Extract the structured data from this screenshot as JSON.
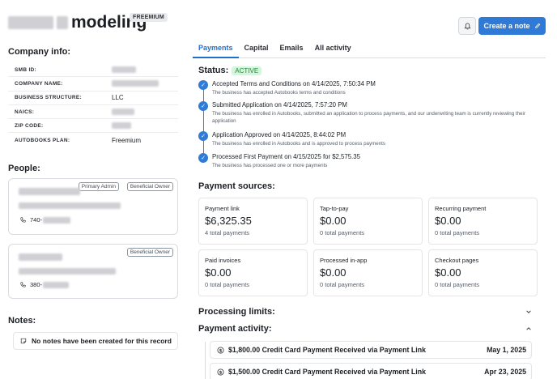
{
  "header": {
    "title_suffix": "modeling",
    "plan_badge": "FREEMIUM",
    "create_note_label": "Create a note",
    "bell_icon": "bell-icon",
    "pencil_icon": "pencil-icon"
  },
  "company_info": {
    "heading": "Company info:",
    "rows": [
      {
        "key": "SMB ID:",
        "value": null
      },
      {
        "key": "COMPANY NAME:",
        "value": null
      },
      {
        "key": "BUSINESS STRUCTURE:",
        "value": "LLC"
      },
      {
        "key": "NAICS:",
        "value": null
      },
      {
        "key": "ZIP CODE:",
        "value": null
      },
      {
        "key": "AUTOBOOKS PLAN:",
        "value": "Freemium"
      }
    ]
  },
  "people": {
    "heading": "People:",
    "cards": [
      {
        "badges": [
          "Primary Admin",
          "Beneficial Owner"
        ],
        "phone_prefix": "740-"
      },
      {
        "badges": [
          "Beneficial Owner"
        ],
        "phone_prefix": "380-"
      }
    ]
  },
  "notes": {
    "heading": "Notes:",
    "empty_text": "No notes have been created for this record"
  },
  "tabs": [
    "Payments",
    "Capital",
    "Emails",
    "All activity"
  ],
  "status": {
    "label": "Status:",
    "value": "ACTIVE",
    "value_color": "#1f8a3a"
  },
  "timeline": [
    {
      "title": "Accepted Terms and Conditions on 4/14/2025, 7:50:34 PM",
      "sub": "The business has accepted Autobooks terms and conditions"
    },
    {
      "title": "Submitted Application on 4/14/2025, 7:57:20 PM",
      "sub": "The business has enrolled in Autobooks, submitted an application to process payments, and our underwriting team is currently reviewing their application"
    },
    {
      "title": "Application Approved on 4/14/2025, 8:44:02 PM",
      "sub": "The business has enrolled in Autobooks and is approved to process payments"
    },
    {
      "title": "Processed First Payment on 4/15/2025 for $2,575.35",
      "sub": "The business has processed one or more payments"
    }
  ],
  "payment_sources": {
    "heading": "Payment sources:",
    "tiles": [
      {
        "label": "Payment link",
        "amount": "$6,325.35",
        "count": "4 total payments"
      },
      {
        "label": "Tap-to-pay",
        "amount": "$0.00",
        "count": "0 total payments"
      },
      {
        "label": "Recurring payment",
        "amount": "$0.00",
        "count": "0 total payments"
      },
      {
        "label": "Paid invoices",
        "amount": "$0.00",
        "count": "0 total payments"
      },
      {
        "label": "Processed in-app",
        "amount": "$0.00",
        "count": "0 total payments"
      },
      {
        "label": "Checkout pages",
        "amount": "$0.00",
        "count": "0 total payments"
      }
    ]
  },
  "processing_limits": {
    "heading": "Processing limits:"
  },
  "payment_activity": {
    "heading": "Payment activity:",
    "items": [
      {
        "text": "$1,800.00 Credit Card Payment Received via Payment Link",
        "date": "May 1, 2025"
      },
      {
        "text": "$1,500.00 Credit Card Payment Received via Payment Link",
        "date": "Apr 23, 2025"
      }
    ]
  },
  "colors": {
    "accent": "#2e7ad6",
    "active_tab": "#1f6fcf",
    "status_bg": "#d5f5dc"
  }
}
